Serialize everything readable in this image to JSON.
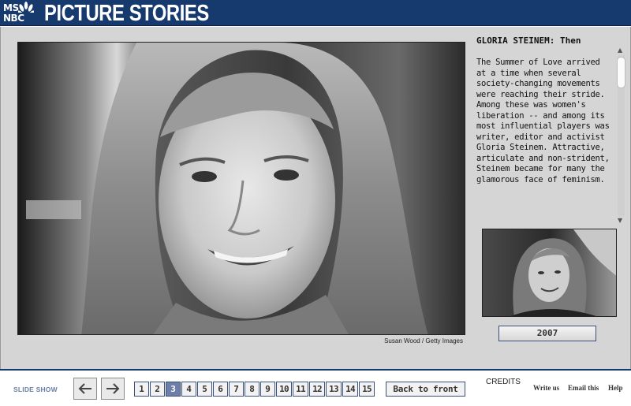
{
  "header": {
    "logo_line1": "MS",
    "logo_line2": "NBC",
    "title": "PICTURE STORIES"
  },
  "photo": {
    "credit": "Susan Wood / Getty Images"
  },
  "caption": {
    "title": "GLORIA STEINEM: Then",
    "text": "The Summer of Love arrived at a time when several society-changing movements were reaching their stride. Among these was women's liberation -- and among its most influential players was writer, editor and activist Gloria Steinem. Attractive, articulate and non-strident, Steinem became for many the glamorous face of feminism."
  },
  "thumbnail": {
    "year_button": "2007"
  },
  "footer": {
    "slide_show_label": "SLIDE SHOW",
    "prev_icon": "arrow-left-icon",
    "next_icon": "arrow-right-icon",
    "pages": [
      "1",
      "2",
      "3",
      "4",
      "5",
      "6",
      "7",
      "8",
      "9",
      "10",
      "11",
      "12",
      "13",
      "14",
      "15"
    ],
    "current_page": "3",
    "back_to_front": "Back to front",
    "credits": "CREDITS",
    "write_us": "Write us",
    "email_this": "Email this",
    "help": "Help"
  },
  "colors": {
    "header_bg": "#173a6e",
    "panel_bg": "#d5d5d5",
    "active_page": "#6d7fa8"
  }
}
